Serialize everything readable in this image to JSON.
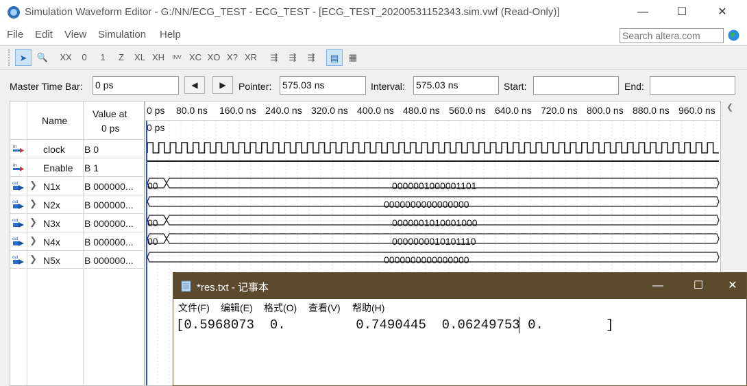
{
  "window": {
    "title": "Simulation Waveform Editor - G:/NN/ECG_TEST - ECG_TEST - [ECG_TEST_20200531152343.sim.vwf (Read-Only)]",
    "minimize": "—",
    "maximize": "☐",
    "close": "✕"
  },
  "menu": [
    "File",
    "Edit",
    "View",
    "Simulation",
    "Help"
  ],
  "search": {
    "placeholder": "Search altera.com"
  },
  "toolbar": {
    "items": [
      {
        "name": "select-tool-icon",
        "glyph": "➤"
      },
      {
        "name": "zoom-tool-icon",
        "glyph": "🔍"
      },
      {
        "name": "force-unknown-icon",
        "glyph": "XX"
      },
      {
        "name": "force-low-icon",
        "glyph": "0"
      },
      {
        "name": "force-high-icon",
        "glyph": "1"
      },
      {
        "name": "force-high-impedance-icon",
        "glyph": "Z"
      },
      {
        "name": "weak-low-icon",
        "glyph": "XL"
      },
      {
        "name": "weak-high-icon",
        "glyph": "XH"
      },
      {
        "name": "invert-icon",
        "glyph": "INV"
      },
      {
        "name": "count-value-icon",
        "glyph": "XC"
      },
      {
        "name": "overwrite-clock-icon",
        "glyph": "XO"
      },
      {
        "name": "arbitrary-value-icon",
        "glyph": "X?"
      },
      {
        "name": "random-value-icon",
        "glyph": "XR"
      },
      {
        "name": "run-functional-simulation-icon",
        "glyph": "⇶"
      },
      {
        "name": "run-timing-simulation-icon",
        "glyph": "⇶"
      },
      {
        "name": "generate-netlist-icon",
        "glyph": "⇶"
      },
      {
        "name": "waveform-view-icon",
        "glyph": "▤"
      },
      {
        "name": "grid-view-icon",
        "glyph": "▦"
      }
    ]
  },
  "timebar": {
    "master_label": "Master Time Bar:",
    "master_value": "0 ps",
    "pointer_label": "Pointer:",
    "pointer_value": "575.03 ns",
    "interval_label": "Interval:",
    "interval_value": "575.03 ns",
    "start_label": "Start:",
    "start_value": "",
    "end_label": "End:",
    "end_value": "",
    "prev_glyph": "◀",
    "next_glyph": "▶"
  },
  "signal_table": {
    "name_header": "Name",
    "value_header_line1": "Value at",
    "value_header_line2": "0 ps",
    "signals": [
      {
        "name": "clock",
        "value": "B 0",
        "type": "in",
        "expandable": false
      },
      {
        "name": "Enable",
        "value": "B 1",
        "type": "in",
        "expandable": false
      },
      {
        "name": "N1x",
        "value": "B 000000...",
        "type": "out",
        "expandable": true
      },
      {
        "name": "N2x",
        "value": "B 000000...",
        "type": "out",
        "expandable": true
      },
      {
        "name": "N3x",
        "value": "B 000000...",
        "type": "out",
        "expandable": true
      },
      {
        "name": "N4x",
        "value": "B 000000...",
        "type": "out",
        "expandable": true
      },
      {
        "name": "N5x",
        "value": "B 000000...",
        "type": "out",
        "expandable": true
      }
    ]
  },
  "waveform": {
    "cursor_label": "0 ps",
    "time_ticks": [
      "0 ps",
      "80.0 ns",
      "160.0 ns",
      "240.0 ns",
      "320.0 ns",
      "400.0 ns",
      "480.0 ns",
      "560.0 ns",
      "640.0 ns",
      "720.0 ns",
      "800.0 ns",
      "880.0 ns",
      "960.0 ns"
    ],
    "clock_cycles": 50,
    "bus_rows": [
      {
        "signal": "N1x",
        "initial": "00",
        "value": "0000001000001101"
      },
      {
        "signal": "N2x",
        "initial": "",
        "value": "0000000000000000"
      },
      {
        "signal": "N3x",
        "initial": "00",
        "value": "0000001010001000"
      },
      {
        "signal": "N4x",
        "initial": "00",
        "value": "0000000010101110"
      },
      {
        "signal": "N5x",
        "initial": "",
        "value": "0000000000000000"
      }
    ],
    "colors": {
      "wave": "#1a1a1a",
      "cursor": "#2a56c6"
    }
  },
  "notepad": {
    "title": "*res.txt - 记事本",
    "menu": [
      "文件(F)",
      "编辑(E)",
      "格式(O)",
      "查看(V)",
      "帮助(H)"
    ],
    "content": "[0.5968073  0.         0.7490445  0.06249753 0.        ]",
    "titlebar_color": "#5c4a2f"
  }
}
